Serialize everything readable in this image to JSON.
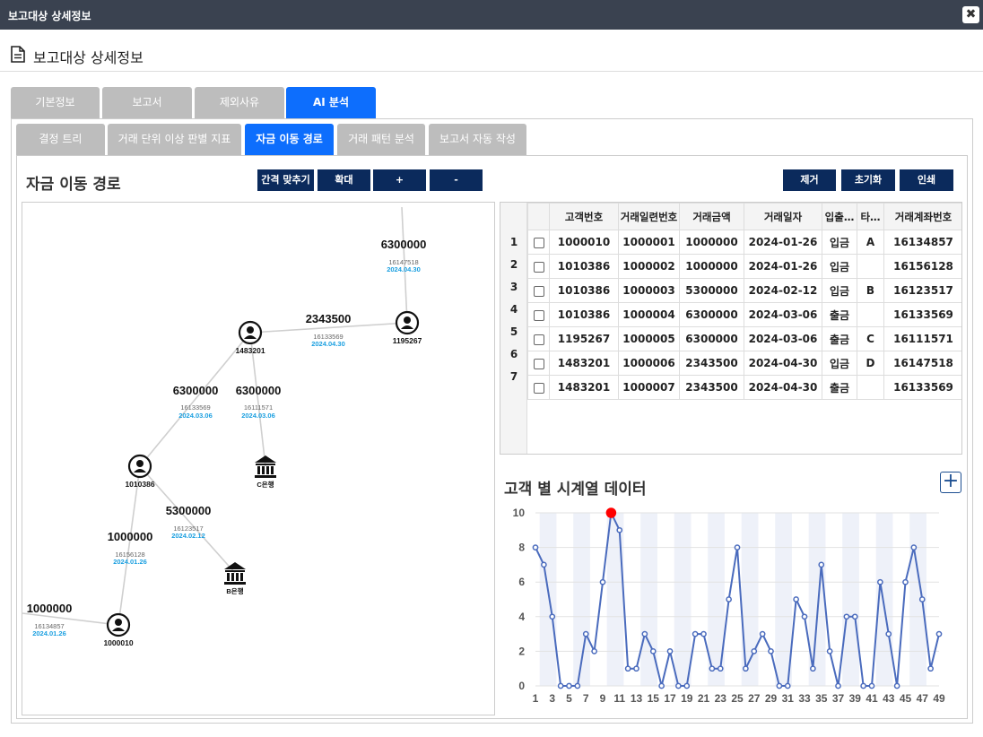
{
  "window": {
    "title": "보고대상 상세정보",
    "close": "✖"
  },
  "header": {
    "title": "보고대상 상세정보"
  },
  "tabs1": [
    "기본정보",
    "보고서",
    "제외사유",
    "AI 분석"
  ],
  "tabs2": [
    "결정 트리",
    "거래 단위 이상 판별 지표",
    "자금 이동 경로",
    "거래 패턴 분석",
    "보고서 자동 작성"
  ],
  "flow": {
    "title": "자금 이동 경로",
    "buttons": [
      "간격 맞추기",
      "확대",
      "+",
      "-"
    ],
    "nodes": [
      {
        "id": "1195267",
        "type": "person"
      },
      {
        "id": "1483201",
        "type": "person"
      },
      {
        "id": "1010386",
        "type": "person"
      },
      {
        "id": "1000010",
        "type": "person"
      },
      {
        "id": "C은행",
        "type": "bank"
      },
      {
        "id": "B은행",
        "type": "bank"
      }
    ],
    "edges": [
      {
        "amount": "6300000",
        "account": "16147518",
        "date": "2024.04.30"
      },
      {
        "amount": "2343500",
        "account": "16133569",
        "date": "2024.04.30"
      },
      {
        "amount": "6300000",
        "account": "16133569",
        "date": "2024.03.06"
      },
      {
        "amount": "6300000",
        "account": "16111571",
        "date": "2024.03.06"
      },
      {
        "amount": "5300000",
        "account": "16123517",
        "date": "2024.02.12"
      },
      {
        "amount": "1000000",
        "account": "16156128",
        "date": "2024.01.26"
      },
      {
        "amount": "1000000",
        "account": "16134857",
        "date": "2024.01.26"
      }
    ]
  },
  "grid": {
    "buttons": [
      "제거",
      "초기화",
      "인쇄"
    ],
    "columns": [
      "고객번호",
      "거래일련번호",
      "거래금액",
      "거래일자",
      "입출…",
      "타…",
      "거래계좌번호"
    ],
    "rows": [
      [
        "1000010",
        "1000001",
        "1000000",
        "2024-01-26",
        "입금",
        "A",
        "16134857"
      ],
      [
        "1010386",
        "1000002",
        "1000000",
        "2024-01-26",
        "입금",
        "",
        "16156128"
      ],
      [
        "1010386",
        "1000003",
        "5300000",
        "2024-02-12",
        "입금",
        "B",
        "16123517"
      ],
      [
        "1010386",
        "1000004",
        "6300000",
        "2024-03-06",
        "출금",
        "",
        "16133569"
      ],
      [
        "1195267",
        "1000005",
        "6300000",
        "2024-03-06",
        "출금",
        "C",
        "16111571"
      ],
      [
        "1483201",
        "1000006",
        "2343500",
        "2024-04-30",
        "입금",
        "D",
        "16147518"
      ],
      [
        "1483201",
        "1000007",
        "2343500",
        "2024-04-30",
        "출금",
        "",
        "16133569"
      ]
    ],
    "row_numbers": [
      "1",
      "2",
      "3",
      "4",
      "5",
      "6",
      "7"
    ]
  },
  "timeseries": {
    "title": "고객 별 시계열 데이터",
    "plus": "+",
    "chart_data": {
      "type": "line",
      "x": [
        1,
        2,
        3,
        4,
        5,
        6,
        7,
        8,
        9,
        10,
        11,
        12,
        13,
        14,
        15,
        16,
        17,
        18,
        19,
        20,
        21,
        22,
        23,
        24,
        25,
        26,
        27,
        28,
        29,
        30,
        31,
        32,
        33,
        34,
        35,
        36,
        37,
        38,
        39,
        40,
        41,
        42,
        43,
        44,
        45,
        46,
        47,
        48,
        49
      ],
      "values": [
        8,
        7,
        4,
        0,
        0,
        0,
        3,
        2,
        6,
        10,
        9,
        1,
        1,
        3,
        2,
        0,
        2,
        0,
        0,
        3,
        3,
        1,
        1,
        5,
        8,
        1,
        2,
        3,
        2,
        0,
        0,
        5,
        4,
        1,
        7,
        2,
        0,
        4,
        4,
        0,
        0,
        6,
        3,
        0,
        6,
        8,
        5,
        1,
        3
      ],
      "xticks": [
        1,
        3,
        5,
        7,
        9,
        11,
        13,
        15,
        17,
        19,
        21,
        23,
        25,
        27,
        29,
        31,
        33,
        35,
        37,
        39,
        41,
        43,
        45,
        47,
        49
      ],
      "ylim": [
        0,
        10
      ],
      "yticks": [
        0,
        2,
        4,
        6,
        8,
        10
      ],
      "highlight_index": 9,
      "line_color": "#4a6bbd",
      "highlight_color": "#ff0000"
    }
  }
}
